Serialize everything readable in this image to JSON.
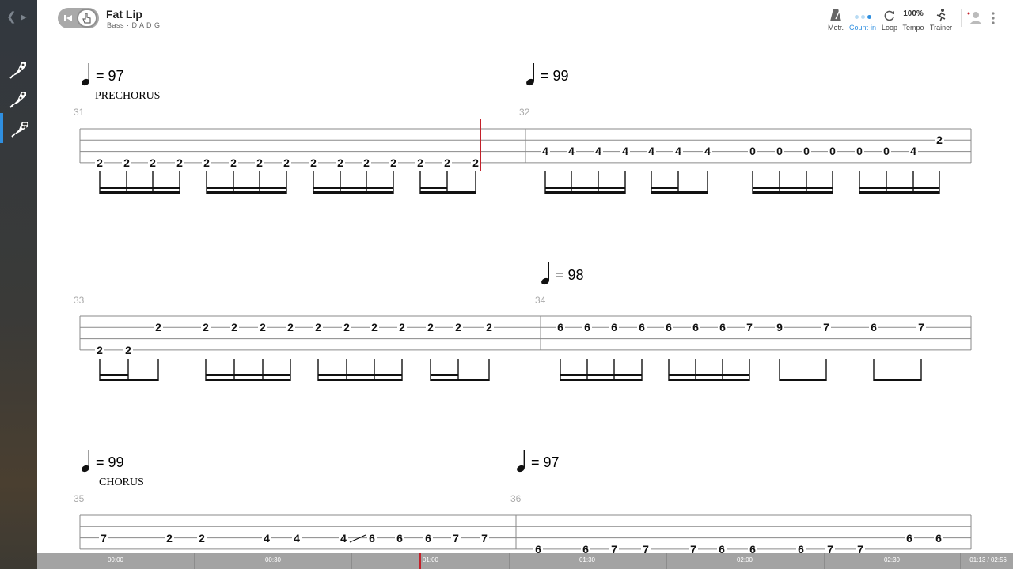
{
  "song": {
    "title": "Fat Lip",
    "instrument": "Bass",
    "tuning": "D A D G"
  },
  "toolbar": {
    "metronome": "Metr.",
    "countin": "Count-in",
    "loop": "Loop",
    "tempo_value": "100%",
    "tempo": "Tempo",
    "trainer": "Trainer"
  },
  "score": {
    "tempos": [
      "= 97",
      "= 99",
      "= 98",
      "= 99",
      "= 97"
    ],
    "sections": [
      "PRECHORUS",
      "CHORUS"
    ],
    "measure_numbers": [
      "31",
      "32",
      "33",
      "34",
      "35",
      "36"
    ]
  },
  "timeline": {
    "labels": [
      "00:00",
      "00:30",
      "01:00",
      "01:30",
      "02:00",
      "02:30"
    ],
    "readout": "01:13 / 02:56",
    "progress": 0.41
  },
  "colors": {
    "accent": "#2f8fe0",
    "playhead": "#c3202a",
    "sidebar": "#3a3a38"
  }
}
